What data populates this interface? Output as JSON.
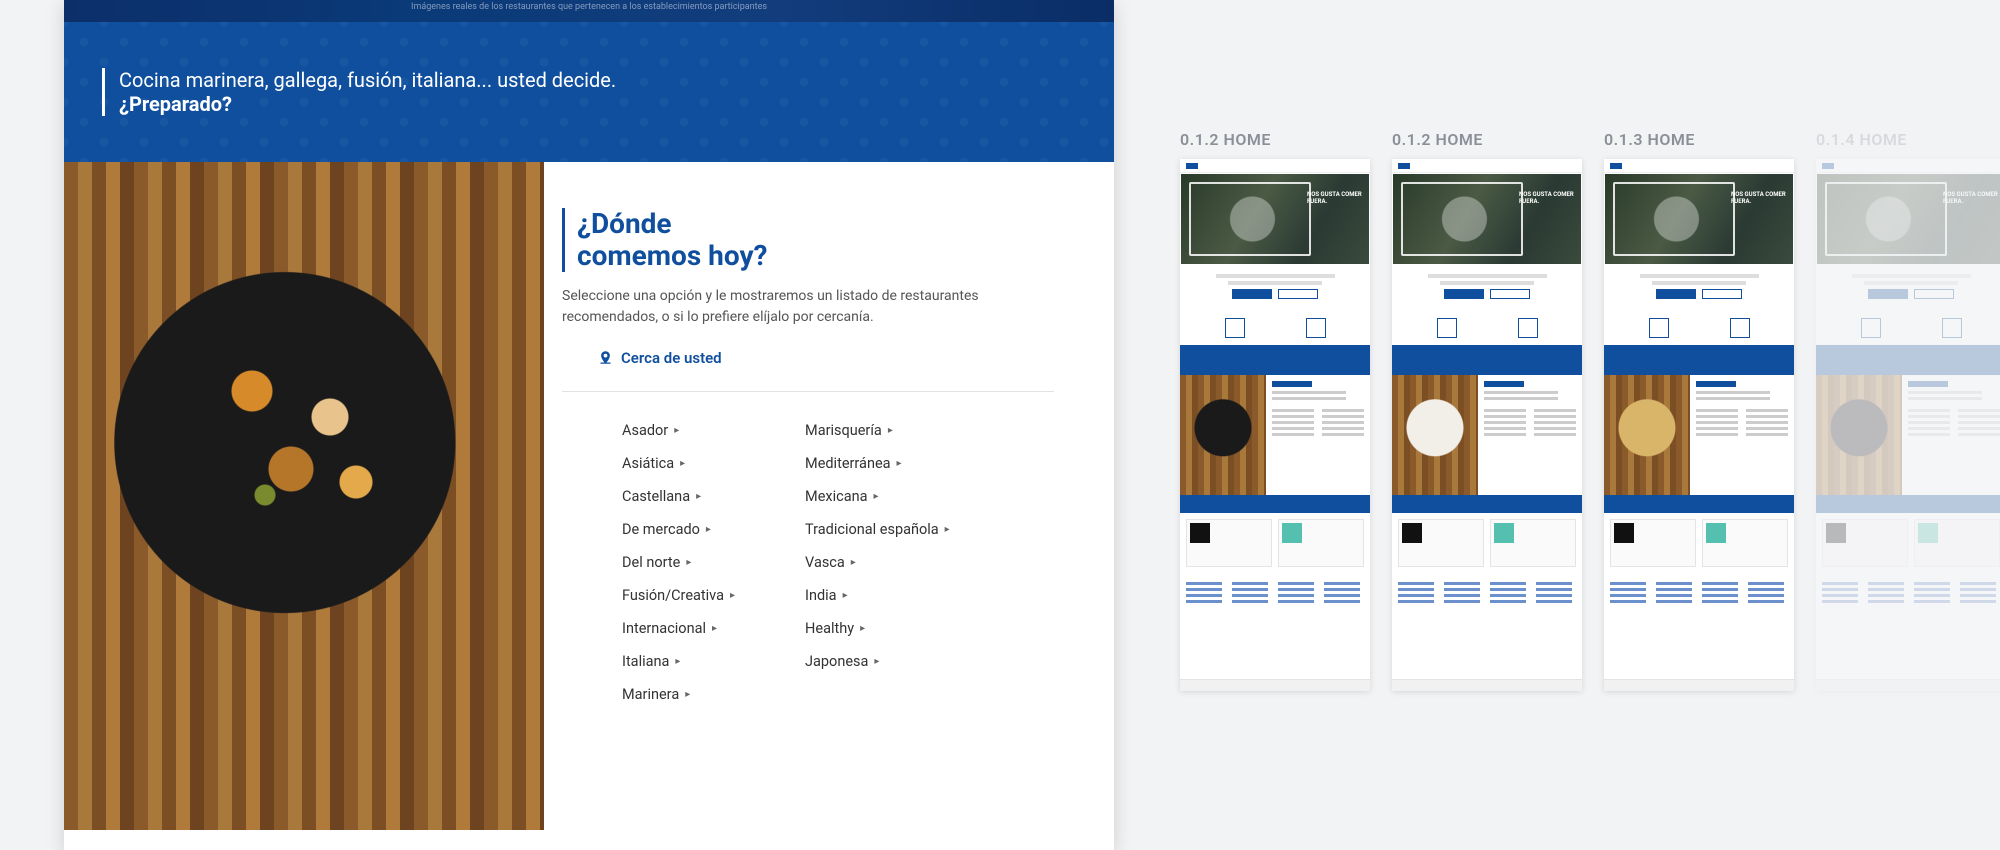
{
  "hero_caption": "Imágenes reales de los restaurantes que pertenecen a los establecimientos participantes",
  "banner": {
    "line1": "Cocina marinera, gallega, fusión, italiana... usted decide.",
    "line2": "¿Preparado?"
  },
  "where": {
    "title_l1": "¿Dónde",
    "title_l2": "comemos hoy?",
    "desc": "Seleccione una opción y le mostraremos un listado de restaurantes recomendados, o si lo prefiere elíjalo por cercanía.",
    "near_label": "Cerca de usted"
  },
  "cuisines_left": [
    "Asador",
    "Asiática",
    "Castellana",
    "De mercado",
    "Del norte",
    "Fusión/Creativa",
    "Internacional",
    "Italiana",
    "Marinera"
  ],
  "cuisines_right": [
    "Marisquería",
    "Mediterránea",
    "Mexicana",
    "Tradicional española",
    "Vasca",
    "India",
    "Healthy",
    "Japonesa"
  ],
  "thumbs": [
    {
      "label": "0.1.2 HOME",
      "plate": "#1a1a1a"
    },
    {
      "label": "0.1.2 HOME",
      "plate": "#f2efe8"
    },
    {
      "label": "0.1.3 HOME",
      "plate": "#d9b56a"
    },
    {
      "label": "0.1.4 HOME",
      "plate": "#1a1a1a",
      "faded": true
    }
  ],
  "thumb_hero_text": "NOS GUSTA COMER FUERA."
}
